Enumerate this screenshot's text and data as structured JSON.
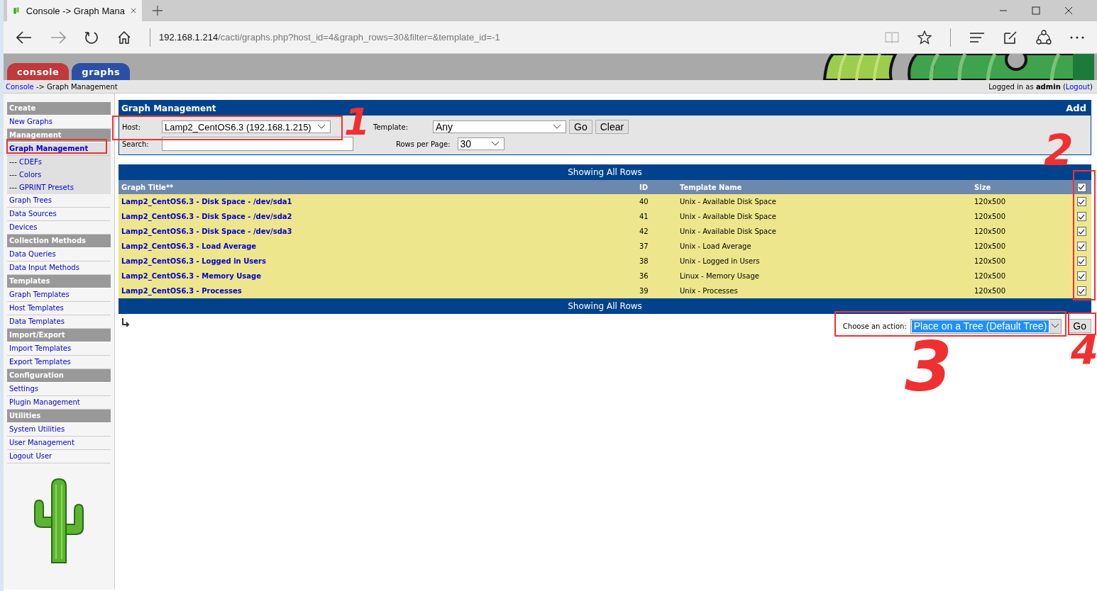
{
  "browser": {
    "tab_title": "Console -> Graph Mana",
    "url_host": "192.168.1.214",
    "url_path": "/cacti/graphs.php?host_id=4&graph_rows=30&filter=&template_id=-1"
  },
  "header_tabs": [
    {
      "label": "console",
      "color": "#c0393b"
    },
    {
      "label": "graphs",
      "color": "#2c4fa6"
    }
  ],
  "breadcrumb": {
    "link": "Console",
    "rest": "-> Graph Management"
  },
  "login": {
    "before": "Logged in as **admin** (",
    "link": "Logout",
    "after": ")"
  },
  "sidebar": [
    {
      "kind": "header",
      "label": "Create"
    },
    {
      "kind": "link",
      "label": "New Graphs",
      "selected": false
    },
    {
      "kind": "header",
      "label": "Management"
    },
    {
      "kind": "link",
      "label": "Graph Management",
      "selected": true
    },
    {
      "kind": "sub",
      "prefix": "---",
      "label": "CDEFs",
      "selected": false
    },
    {
      "kind": "sub",
      "prefix": "---",
      "label": "Colors",
      "selected": false
    },
    {
      "kind": "sub",
      "prefix": "---",
      "label": "GPRINT Presets",
      "selected": false
    },
    {
      "kind": "link",
      "label": "Graph Trees",
      "selected": false
    },
    {
      "kind": "link",
      "label": "Data Sources",
      "selected": false
    },
    {
      "kind": "link",
      "label": "Devices",
      "selected": false
    },
    {
      "kind": "header",
      "label": "Collection Methods"
    },
    {
      "kind": "link",
      "label": "Data Queries",
      "selected": false
    },
    {
      "kind": "link",
      "label": "Data Input Methods",
      "selected": false
    },
    {
      "kind": "header",
      "label": "Templates"
    },
    {
      "kind": "link",
      "label": "Graph Templates",
      "selected": false
    },
    {
      "kind": "link",
      "label": "Host Templates",
      "selected": false
    },
    {
      "kind": "link",
      "label": "Data Templates",
      "selected": false
    },
    {
      "kind": "header",
      "label": "Import/Export"
    },
    {
      "kind": "link",
      "label": "Import Templates",
      "selected": false
    },
    {
      "kind": "link",
      "label": "Export Templates",
      "selected": false
    },
    {
      "kind": "header",
      "label": "Configuration"
    },
    {
      "kind": "link",
      "label": "Settings",
      "selected": false
    },
    {
      "kind": "link",
      "label": "Plugin Management",
      "selected": false
    },
    {
      "kind": "header",
      "label": "Utilities"
    },
    {
      "kind": "link",
      "label": "System Utilities",
      "selected": false
    },
    {
      "kind": "link",
      "label": "User Management",
      "selected": false
    },
    {
      "kind": "link",
      "label": "Logout User",
      "selected": false
    }
  ],
  "filter": {
    "title": "Graph Management",
    "add": "Add",
    "host_label": "Host:",
    "host_value": "Lamp2_CentOS6.3 (192.168.1.215)",
    "template_label": "Template:",
    "template_value": "Any",
    "go": "Go",
    "clear": "Clear",
    "search_label": "Search:",
    "rows_label": "Rows per Page:",
    "rows_value": "30"
  },
  "table": {
    "banner_top": "Showing All Rows",
    "banner_bottom": "Showing All Rows",
    "columns": [
      "Graph Title**",
      "ID",
      "Template Name",
      "Size"
    ],
    "all_checked": true,
    "rows": [
      {
        "title": "Lamp2_CentOS6.3 - Disk Space - /dev/sda1",
        "id": "40",
        "template": "Unix - Available Disk Space",
        "size": "120x500",
        "checked": true
      },
      {
        "title": "Lamp2_CentOS6.3 - Disk Space - /dev/sda2",
        "id": "41",
        "template": "Unix - Available Disk Space",
        "size": "120x500",
        "checked": true
      },
      {
        "title": "Lamp2_CentOS6.3 - Disk Space - /dev/sda3",
        "id": "42",
        "template": "Unix - Available Disk Space",
        "size": "120x500",
        "checked": true
      },
      {
        "title": "Lamp2_CentOS6.3 - Load Average",
        "id": "37",
        "template": "Unix - Load Average",
        "size": "120x500",
        "checked": true
      },
      {
        "title": "Lamp2_CentOS6.3 - Logged in Users",
        "id": "38",
        "template": "Unix - Logged in Users",
        "size": "120x500",
        "checked": true
      },
      {
        "title": "Lamp2_CentOS6.3 - Memory Usage",
        "id": "36",
        "template": "Linux - Memory Usage",
        "size": "120x500",
        "checked": true
      },
      {
        "title": "Lamp2_CentOS6.3 - Processes",
        "id": "39",
        "template": "Unix - Processes",
        "size": "120x500",
        "checked": true
      }
    ]
  },
  "action": {
    "label": "Choose an action:",
    "value": "Place on a Tree (Default Tree)",
    "go": "Go"
  },
  "annotations": [
    {
      "label": "1"
    },
    {
      "label": "2"
    },
    {
      "label": "3"
    },
    {
      "label": "4"
    }
  ]
}
